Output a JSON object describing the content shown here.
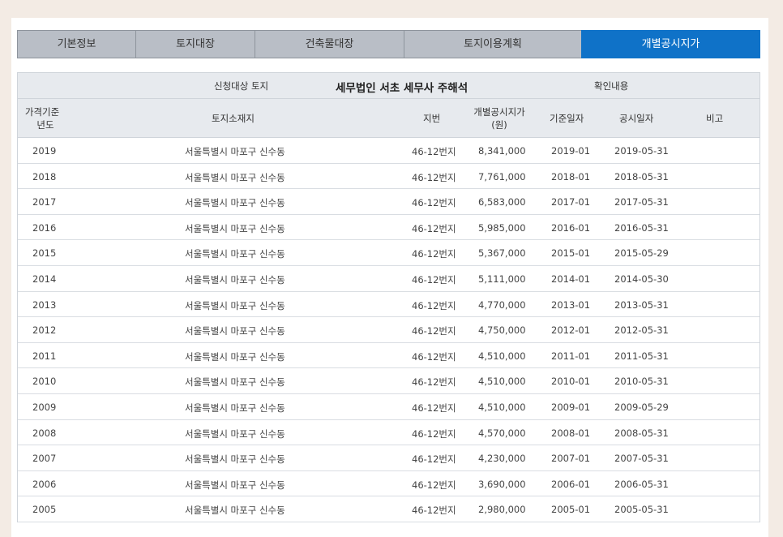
{
  "tabs": [
    {
      "label": "기본정보",
      "active": false
    },
    {
      "label": "토지대장",
      "active": false
    },
    {
      "label": "건축물대장",
      "active": false
    },
    {
      "label": "토지이용계획",
      "active": false
    },
    {
      "label": "개별공시지가",
      "active": true
    }
  ],
  "summary": {
    "applicant_label": "신청대상 토지",
    "applicant_value": "세무법인 서초 세무사 주해석",
    "confirm_label": "확인내용"
  },
  "columns": {
    "year_line1": "가격기준",
    "year_line2": "년도",
    "address": "토지소재지",
    "lot": "지번",
    "price_line1": "개별공시지가",
    "price_line2": "(원)",
    "base_date": "기준일자",
    "pub_date": "공시일자",
    "note": "비고"
  },
  "rows": [
    {
      "year": "2019",
      "address": "서울특별시 마포구 신수동",
      "lot": "46-12번지",
      "price": "8,341,000",
      "base": "2019-01",
      "pub": "2019-05-31",
      "note": ""
    },
    {
      "year": "2018",
      "address": "서울특별시 마포구 신수동",
      "lot": "46-12번지",
      "price": "7,761,000",
      "base": "2018-01",
      "pub": "2018-05-31",
      "note": ""
    },
    {
      "year": "2017",
      "address": "서울특별시 마포구 신수동",
      "lot": "46-12번지",
      "price": "6,583,000",
      "base": "2017-01",
      "pub": "2017-05-31",
      "note": ""
    },
    {
      "year": "2016",
      "address": "서울특별시 마포구 신수동",
      "lot": "46-12번지",
      "price": "5,985,000",
      "base": "2016-01",
      "pub": "2016-05-31",
      "note": ""
    },
    {
      "year": "2015",
      "address": "서울특별시 마포구 신수동",
      "lot": "46-12번지",
      "price": "5,367,000",
      "base": "2015-01",
      "pub": "2015-05-29",
      "note": ""
    },
    {
      "year": "2014",
      "address": "서울특별시 마포구 신수동",
      "lot": "46-12번지",
      "price": "5,111,000",
      "base": "2014-01",
      "pub": "2014-05-30",
      "note": ""
    },
    {
      "year": "2013",
      "address": "서울특별시 마포구 신수동",
      "lot": "46-12번지",
      "price": "4,770,000",
      "base": "2013-01",
      "pub": "2013-05-31",
      "note": ""
    },
    {
      "year": "2012",
      "address": "서울특별시 마포구 신수동",
      "lot": "46-12번지",
      "price": "4,750,000",
      "base": "2012-01",
      "pub": "2012-05-31",
      "note": ""
    },
    {
      "year": "2011",
      "address": "서울특별시 마포구 신수동",
      "lot": "46-12번지",
      "price": "4,510,000",
      "base": "2011-01",
      "pub": "2011-05-31",
      "note": ""
    },
    {
      "year": "2010",
      "address": "서울특별시 마포구 신수동",
      "lot": "46-12번지",
      "price": "4,510,000",
      "base": "2010-01",
      "pub": "2010-05-31",
      "note": ""
    },
    {
      "year": "2009",
      "address": "서울특별시 마포구 신수동",
      "lot": "46-12번지",
      "price": "4,510,000",
      "base": "2009-01",
      "pub": "2009-05-29",
      "note": ""
    },
    {
      "year": "2008",
      "address": "서울특별시 마포구 신수동",
      "lot": "46-12번지",
      "price": "4,570,000",
      "base": "2008-01",
      "pub": "2008-05-31",
      "note": ""
    },
    {
      "year": "2007",
      "address": "서울특별시 마포구 신수동",
      "lot": "46-12번지",
      "price": "4,230,000",
      "base": "2007-01",
      "pub": "2007-05-31",
      "note": ""
    },
    {
      "year": "2006",
      "address": "서울특별시 마포구 신수동",
      "lot": "46-12번지",
      "price": "3,690,000",
      "base": "2006-01",
      "pub": "2006-05-31",
      "note": ""
    },
    {
      "year": "2005",
      "address": "서울특별시 마포구 신수동",
      "lot": "46-12번지",
      "price": "2,980,000",
      "base": "2005-01",
      "pub": "2005-05-31",
      "note": ""
    }
  ],
  "colors": {
    "active_tab": "#0f72c8",
    "inactive_tab": "#b9bec6",
    "header_bg": "#e7eaee",
    "page_bg": "#f3ebe4"
  }
}
